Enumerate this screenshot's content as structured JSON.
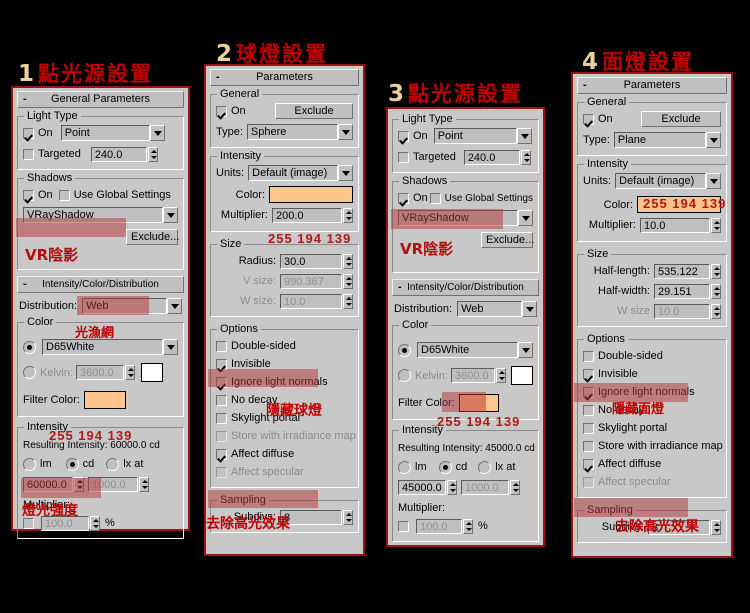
{
  "colors": {
    "filter_swatch": "#FFC48B",
    "highlight": "rgba(180,55,55,0.52)",
    "annotation_red": "#C00000",
    "heading_num": "#E8D49A",
    "panel_bg": "#C8C8C8",
    "panel_border": "#9B1414"
  },
  "panels": [
    {
      "heading_num": "1",
      "heading_text": "點光源設置",
      "rollout": {
        "minus": "-",
        "title": "General Parameters"
      },
      "groups": {
        "light_type": {
          "title": "Light Type",
          "on_label": "On",
          "on_checked": true,
          "type_value": "Point",
          "targeted_label": "Targeted",
          "targeted_checked": false,
          "targeted_value": "240.0"
        },
        "shadows": {
          "title": "Shadows",
          "on_label": "On",
          "on_checked": true,
          "use_global_label": "Use Global Settings",
          "use_global_checked": false,
          "shadow_type": "VRayShadow",
          "exclude_label": "Exclude...",
          "annotation": "VR陰影"
        },
        "icd": {
          "rollout_minus": "-",
          "rollout_title": "Intensity/Color/Distribution",
          "distribution_label": "Distribution:",
          "distribution_value": "Web",
          "distribution_annotation": "光漁網",
          "color_title": "Color",
          "preset_selected": true,
          "preset_value": "D65White",
          "kelvin_selected": false,
          "kelvin_label": "Kelvin:",
          "kelvin_value": "3600.0",
          "filter_color_label": "Filter Color:",
          "filter_rgb": "255  194  139",
          "intensity_title": "Intensity",
          "resulting_label": "Resulting Intensity: 60000.0 cd",
          "unit_lm": "lm",
          "unit_cd": "cd",
          "unit_lx": "lx at",
          "unit_selected": "cd",
          "intensity_value": "60000.0",
          "lx_value": "1000.0",
          "intensity_annotation": "燈光強度",
          "multiplier_label": "Multiplier:",
          "multiplier_checked": false,
          "multiplier_value": "100.0",
          "percent": "%"
        }
      }
    },
    {
      "heading_num": "2",
      "heading_text": "球燈設置",
      "rollout": {
        "minus": "-",
        "title": "Parameters"
      },
      "groups": {
        "general": {
          "title": "General",
          "on_label": "On",
          "on_checked": true,
          "exclude_label": "Exclude",
          "type_label": "Type:",
          "type_value": "Sphere"
        },
        "intensity": {
          "title": "Intensity",
          "units_label": "Units:",
          "units_value": "Default (image)",
          "color_label": "Color:",
          "multiplier_label": "Multiplier:",
          "multiplier_value": "200.0",
          "filter_rgb": "255  194  139"
        },
        "size": {
          "title": "Size",
          "radius_label": "Radius:",
          "radius_value": "30.0",
          "vsize_label": "V size:",
          "vsize_value": "990.367",
          "wsize_label": "W size:",
          "wsize_value": "10.0"
        },
        "options": {
          "title": "Options",
          "items": [
            {
              "label": "Double-sided",
              "checked": false,
              "dim": false,
              "highlight": false
            },
            {
              "label": "Invisible",
              "checked": true,
              "dim": false,
              "highlight": true
            },
            {
              "label": "Ignore light normals",
              "checked": true,
              "dim": false,
              "highlight": false
            },
            {
              "label": "No decay",
              "checked": false,
              "dim": false,
              "highlight": false
            },
            {
              "label": "Skylight portal",
              "checked": false,
              "dim": false,
              "highlight": false
            },
            {
              "label": "Store with irradiance map",
              "checked": false,
              "dim": true,
              "highlight": false
            },
            {
              "label": "Affect diffuse",
              "checked": true,
              "dim": false,
              "highlight": false
            },
            {
              "label": "Affect specular",
              "checked": false,
              "dim": true,
              "highlight": true
            }
          ],
          "annotation_invisible": "隱藏球燈",
          "annotation_specular": "去除高光效果"
        },
        "sampling": {
          "title": "Sampling",
          "subdivs_label": "Subdivs:",
          "subdivs_value": "8"
        }
      }
    },
    {
      "heading_num": "3",
      "heading_text": "點光源設置",
      "groups": {
        "light_type": {
          "title": "Light Type",
          "on_label": "On",
          "on_checked": true,
          "type_value": "Point",
          "targeted_label": "Targeted",
          "targeted_checked": false,
          "targeted_value": "240.0"
        },
        "shadows": {
          "title": "Shadows",
          "on_label": "On",
          "on_checked": true,
          "use_global_label": "Use Global Settings",
          "use_global_checked": false,
          "shadow_type": "VRayShadow",
          "exclude_label": "Exclude...",
          "annotation": "VR陰影"
        },
        "icd": {
          "rollout_minus": "-",
          "rollout_title": "Intensity/Color/Distribution",
          "distribution_label": "Distribution:",
          "distribution_value": "Web",
          "color_title": "Color",
          "preset_selected": true,
          "preset_value": "D65White",
          "kelvin_selected": false,
          "kelvin_label": "Kelvin:",
          "kelvin_value": "3600.0",
          "filter_color_label": "Filter Color:",
          "filter_rgb": "255  194  139",
          "intensity_title": "Intensity",
          "resulting_label": "Resulting Intensity: 45000.0 cd",
          "unit_lm": "lm",
          "unit_cd": "cd",
          "unit_lx": "lx at",
          "unit_selected": "cd",
          "intensity_value": "45000.0",
          "lx_value": "1000.0",
          "multiplier_label": "Multiplier:",
          "multiplier_checked": false,
          "multiplier_value": "100.0",
          "percent": "%"
        }
      }
    },
    {
      "heading_num": "4",
      "heading_text": "面燈設置",
      "rollout": {
        "minus": "-",
        "title": "Parameters"
      },
      "groups": {
        "general": {
          "title": "General",
          "on_label": "On",
          "on_checked": true,
          "exclude_label": "Exclude",
          "type_label": "Type:",
          "type_value": "Plane"
        },
        "intensity": {
          "title": "Intensity",
          "units_label": "Units:",
          "units_value": "Default (image)",
          "color_label": "Color:",
          "multiplier_label": "Multiplier:",
          "multiplier_value": "10.0",
          "filter_rgb": "255  194  139"
        },
        "size": {
          "title": "Size",
          "halflength_label": "Half-length:",
          "halflength_value": "535.122",
          "halfwidth_label": "Half-width:",
          "halfwidth_value": "29.151",
          "wsize_label": "W size",
          "wsize_value": "10.0"
        },
        "options": {
          "title": "Options",
          "items": [
            {
              "label": "Double-sided",
              "checked": false,
              "dim": false,
              "highlight": false
            },
            {
              "label": "Invisible",
              "checked": true,
              "dim": false,
              "highlight": true
            },
            {
              "label": "Ignore light normals",
              "checked": true,
              "dim": false,
              "highlight": false
            },
            {
              "label": "No decay",
              "checked": false,
              "dim": false,
              "highlight": false
            },
            {
              "label": "Skylight portal",
              "checked": false,
              "dim": false,
              "highlight": false
            },
            {
              "label": "Store with irradiance map",
              "checked": false,
              "dim": true,
              "highlight": false
            },
            {
              "label": "Affect diffuse",
              "checked": true,
              "dim": false,
              "highlight": false
            },
            {
              "label": "Affect specular",
              "checked": false,
              "dim": true,
              "highlight": true
            }
          ],
          "annotation_invisible": "隱藏面燈",
          "annotation_specular": "去除高光效果"
        },
        "sampling": {
          "title": "Sampling",
          "subdivs_label": "Subdivs:",
          "subdivs_value": "8"
        }
      }
    }
  ]
}
